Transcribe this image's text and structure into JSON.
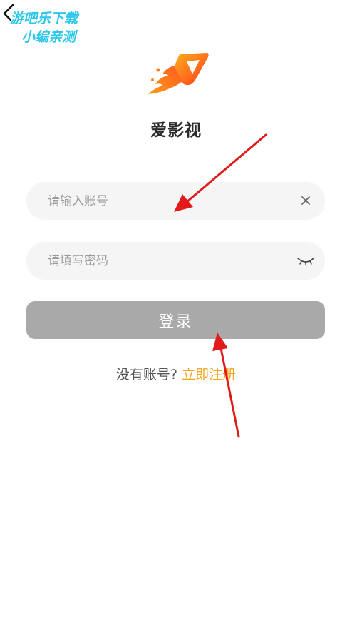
{
  "watermark": {
    "line1": "游吧乐下载",
    "line2": "小编亲测"
  },
  "app": {
    "name": "爱影视"
  },
  "account_field": {
    "placeholder": "请输入账号",
    "value": ""
  },
  "password_field": {
    "placeholder": "请填写密码",
    "value": ""
  },
  "login_button": {
    "label": "登录"
  },
  "register": {
    "prompt": "没有账号?",
    "link": "立即注册"
  },
  "icons": {
    "back": "chevron-left-icon",
    "logo": "app-logo",
    "clear": "close-icon",
    "password_toggle": "eye-closed-icon"
  },
  "colors": {
    "button_disabled": "#a9a9a9",
    "link_accent": "#f5a623",
    "field_background": "#f5f5f5",
    "annotation_arrow": "#e11b1b"
  }
}
